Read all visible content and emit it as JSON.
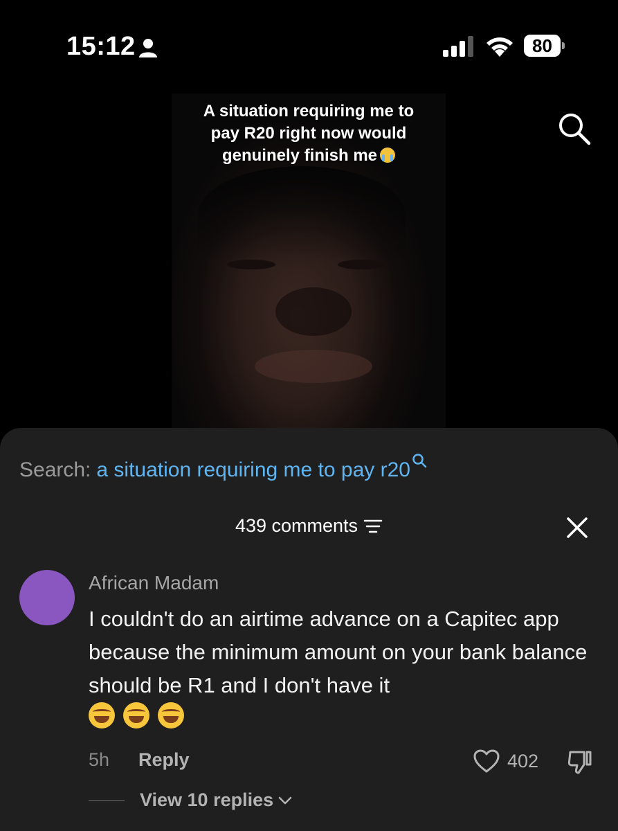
{
  "status_bar": {
    "time": "15:12",
    "battery": "80"
  },
  "video": {
    "caption_lines": [
      "A situation requiring me to",
      "pay R20 right now would",
      "genuinely finish me"
    ],
    "caption_emoji": "loudly-crying-face"
  },
  "icons": {
    "person": "person-icon",
    "signal": "signal-icon",
    "wifi": "wifi-icon",
    "search": "search-icon",
    "sort": "sort-icon",
    "close": "close-icon",
    "heart": "heart-icon",
    "dislike": "dislike-icon",
    "chevron": "chevron-down-icon"
  },
  "search": {
    "prefix": "Search:",
    "query": "a situation requiring me to pay r20"
  },
  "comments": {
    "count_label": "439 comments"
  },
  "comment": {
    "username": "African Madam",
    "text": "I couldn't do an airtime advance on a Capitec app because the minimum amount on your bank balance should be R1 and I don't have it",
    "emojis": [
      "face-with-tears-of-joy",
      "face-with-tears-of-joy",
      "face-with-tears-of-joy"
    ],
    "timestamp": "5h",
    "reply_label": "Reply",
    "likes": "402",
    "view_replies": "View 10 replies"
  },
  "colors": {
    "background": "#000000",
    "sheet": "#1f1f1f",
    "link_blue": "#5fb4f2",
    "avatar": "#8a56c0"
  }
}
